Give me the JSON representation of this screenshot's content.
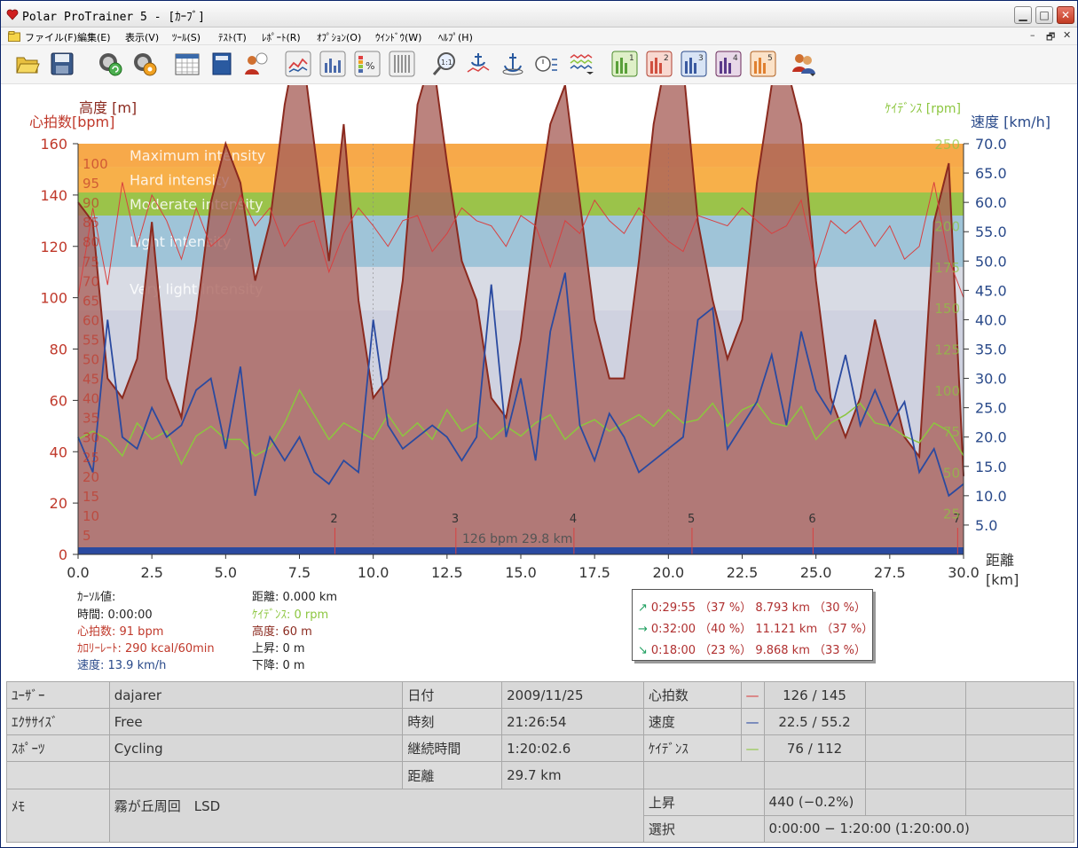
{
  "window": {
    "title": "Polar ProTrainer 5 - [ｶｰﾌﾞ]"
  },
  "menu": [
    "ファイル(F)",
    "編集(E)",
    "表示(V)",
    "ﾂｰﾙ(S)",
    "ﾃｽﾄ(T)",
    "ﾚﾎﾟｰﾄ(R)",
    "ｵﾌﾟｼｮﾝ(O)",
    "ｳｲﾝﾄﾞｳ(W)",
    "ﾍﾙﾌﾟ(H)"
  ],
  "toolbar": {
    "icons": [
      "open-folder-icon",
      "save-icon",
      "sync-icon",
      "settings-icon",
      "calendar-icon",
      "book-icon",
      "user-info-icon",
      "line-chart-icon",
      "bar-chart-icon",
      "percent-chart-icon",
      "table-icon",
      "zoom-1to1-icon",
      "anchor-chart-icon",
      "anchor-icon",
      "stopwatch-icon",
      "multi-line-icon",
      "view-1-icon",
      "view-2-icon",
      "view-3-icon",
      "view-4-icon",
      "view-5-icon",
      "users-icon"
    ],
    "view_numbers": [
      "1",
      "2",
      "3",
      "4",
      "5"
    ],
    "zoom_label": "1:1"
  },
  "chart_data": {
    "type": "line",
    "axes": {
      "left_hr": {
        "label": "心拍数[bpm]",
        "range": [
          0,
          160
        ],
        "ticks": [
          "0",
          "20",
          "40",
          "60",
          "80",
          "100",
          "120",
          "140",
          "160"
        ],
        "color": "#c0392b"
      },
      "left_alt": {
        "label": "高度 [m]",
        "ticks": [
          "5",
          "10",
          "15",
          "20",
          "25",
          "30",
          "35",
          "40",
          "45",
          "50",
          "55",
          "60",
          "65",
          "70",
          "75",
          "80",
          "85",
          "90",
          "95",
          "100"
        ],
        "color": "#c0392b"
      },
      "right_speed": {
        "label": "速度 [km/h]",
        "range": [
          0,
          70
        ],
        "ticks": [
          "5.0",
          "10.0",
          "15.0",
          "20.0",
          "25.0",
          "30.0",
          "35.0",
          "40.0",
          "45.0",
          "50.0",
          "55.0",
          "60.0",
          "65.0",
          "70.0"
        ],
        "color": "#2a4a8a"
      },
      "right_cadence": {
        "label": "ｹｲﾃﾞﾝｽ [rpm]",
        "ticks": [
          "25",
          "50",
          "75",
          "100",
          "125",
          "150",
          "175",
          "200",
          "250"
        ],
        "color": "#8cc63f"
      },
      "x": {
        "label": "距離",
        "unit": "[km]",
        "range": [
          0,
          30
        ],
        "ticks": [
          "0.0",
          "2.5",
          "5.0",
          "7.5",
          "10.0",
          "12.5",
          "15.0",
          "17.5",
          "20.0",
          "22.5",
          "25.0",
          "27.5",
          "30.0"
        ]
      }
    },
    "zones": [
      {
        "name": "Maximum intensity",
        "from": 151,
        "to": 160,
        "color": "#f7a94a"
      },
      {
        "name": "Hard intensity",
        "from": 141,
        "to": 151,
        "color": "#f7b04a"
      },
      {
        "name": "Moderate intensity",
        "from": 132,
        "to": 141,
        "color": "#9bc34a"
      },
      {
        "name": "Light intensity",
        "from": 112,
        "to": 132,
        "color": "#9fc4d8"
      },
      {
        "name": "Very light intensity",
        "from": 95,
        "to": 112,
        "color": "#d8dbe4"
      }
    ],
    "laps": [
      "2",
      "3",
      "4",
      "5",
      "6",
      "7"
    ],
    "lap_x": [
      8.7,
      12.8,
      16.8,
      20.8,
      24.9,
      29.8
    ],
    "cursor_label": "126 bpm 29.8 km",
    "series": [
      {
        "name": "高度",
        "color": "#8b2a1f",
        "x": [
          0,
          0.5,
          1,
          1.5,
          2,
          2.5,
          3,
          3.5,
          4,
          4.5,
          5,
          5.5,
          6,
          6.5,
          7,
          7.5,
          8,
          8.5,
          9,
          9.5,
          10,
          10.5,
          11,
          11.5,
          12,
          12.5,
          13,
          13.5,
          14,
          14.5,
          15,
          15.5,
          16,
          16.5,
          17,
          17.5,
          18,
          18.5,
          19,
          19.5,
          20,
          20.5,
          21,
          21.5,
          22,
          22.5,
          23,
          23.5,
          24,
          24.5,
          25,
          25.5,
          26,
          26.5,
          27,
          27.5,
          28,
          28.5,
          29,
          29.5,
          30
        ],
        "y": [
          90,
          85,
          45,
          40,
          50,
          85,
          45,
          35,
          60,
          90,
          105,
          95,
          70,
          85,
          115,
          135,
          105,
          75,
          110,
          65,
          40,
          45,
          70,
          115,
          128,
          100,
          75,
          65,
          40,
          35,
          55,
          85,
          110,
          120,
          90,
          60,
          45,
          45,
          75,
          110,
          130,
          125,
          85,
          65,
          50,
          60,
          95,
          120,
          125,
          110,
          70,
          40,
          30,
          40,
          60,
          45,
          30,
          25,
          85,
          100,
          20
        ]
      },
      {
        "name": "心拍数",
        "color": "#d84040",
        "x": [
          0,
          0.5,
          1,
          1.5,
          2,
          2.5,
          3,
          3.5,
          4,
          4.5,
          5,
          5.5,
          6,
          6.5,
          7,
          7.5,
          8,
          8.5,
          9,
          9.5,
          10,
          10.5,
          11,
          11.5,
          12,
          12.5,
          13,
          13.5,
          14,
          14.5,
          15,
          15.5,
          16,
          16.5,
          17,
          17.5,
          18,
          18.5,
          19,
          19.5,
          20,
          20.5,
          21,
          21.5,
          22,
          22.5,
          23,
          23.5,
          24,
          24.5,
          25,
          25.5,
          26,
          26.5,
          27,
          27.5,
          28,
          28.5,
          29,
          29.5,
          30
        ],
        "y": [
          100,
          135,
          105,
          145,
          120,
          140,
          130,
          115,
          135,
          120,
          125,
          140,
          128,
          135,
          120,
          128,
          130,
          110,
          125,
          135,
          128,
          120,
          130,
          132,
          118,
          125,
          135,
          130,
          128,
          120,
          132,
          128,
          112,
          130,
          125,
          138,
          130,
          125,
          135,
          128,
          122,
          118,
          132,
          130,
          128,
          135,
          130,
          125,
          128,
          138,
          112,
          130,
          125,
          130,
          120,
          128,
          115,
          120,
          145,
          115,
          100
        ]
      },
      {
        "name": "速度",
        "color": "#2a4aa0",
        "x": [
          0,
          0.5,
          1,
          1.5,
          2,
          2.5,
          3,
          3.5,
          4,
          4.5,
          5,
          5.5,
          6,
          6.5,
          7,
          7.5,
          8,
          8.5,
          9,
          9.5,
          10,
          10.5,
          11,
          11.5,
          12,
          12.5,
          13,
          13.5,
          14,
          14.5,
          15,
          15.5,
          16,
          16.5,
          17,
          17.5,
          18,
          18.5,
          19,
          19.5,
          20,
          20.5,
          21,
          21.5,
          22,
          22.5,
          23,
          23.5,
          24,
          24.5,
          25,
          25.5,
          26,
          26.5,
          27,
          27.5,
          28,
          28.5,
          29,
          29.5,
          30
        ],
        "y": [
          20,
          14,
          40,
          20,
          18,
          25,
          20,
          22,
          28,
          30,
          18,
          32,
          10,
          20,
          16,
          20,
          14,
          12,
          16,
          14,
          40,
          22,
          18,
          20,
          22,
          20,
          16,
          20,
          46,
          20,
          30,
          16,
          38,
          48,
          22,
          16,
          24,
          20,
          14,
          16,
          18,
          20,
          40,
          42,
          18,
          22,
          26,
          34,
          22,
          38,
          28,
          24,
          34,
          22,
          28,
          22,
          26,
          14,
          18,
          10,
          12
        ]
      },
      {
        "name": "ｹｲﾃﾞﾝｽ",
        "color": "#8cc63f",
        "x": [
          0,
          0.5,
          1,
          1.5,
          2,
          2.5,
          3,
          3.5,
          4,
          4.5,
          5,
          5.5,
          6,
          6.5,
          7,
          7.5,
          8,
          8.5,
          9,
          9.5,
          10,
          10.5,
          11,
          11.5,
          12,
          12.5,
          13,
          13.5,
          14,
          14.5,
          15,
          15.5,
          16,
          16.5,
          17,
          17.5,
          18,
          18.5,
          19,
          19.5,
          20,
          20.5,
          21,
          21.5,
          22,
          22.5,
          23,
          23.5,
          24,
          24.5,
          25,
          25.5,
          26,
          26.5,
          27,
          27.5,
          28,
          28.5,
          29,
          29.5,
          30
        ],
        "y": [
          70,
          75,
          70,
          60,
          80,
          70,
          75,
          55,
          72,
          78,
          70,
          70,
          60,
          65,
          80,
          100,
          85,
          70,
          80,
          75,
          70,
          85,
          72,
          80,
          70,
          88,
          75,
          80,
          70,
          78,
          72,
          80,
          85,
          70,
          78,
          82,
          75,
          80,
          85,
          78,
          88,
          80,
          82,
          92,
          78,
          88,
          92,
          80,
          78,
          90,
          70,
          80,
          85,
          92,
          80,
          78,
          72,
          68,
          80,
          75,
          60
        ]
      }
    ]
  },
  "cursor": {
    "title": "ｶｰｿﾙ値:",
    "time": "時間: 0:00:00",
    "hr": "心拍数: 91 bpm",
    "calorie": "ｶﾛﾘｰﾚｰﾄ: 290 kcal/60min",
    "speed": "速度: 13.9 km/h",
    "distance": "距離: 0.000 km",
    "cadence": "ｹｲﾃﾞﾝｽ: 0 rpm",
    "altitude": "高度: 60 m",
    "ascent": "上昇: 0 m",
    "descent": "下降: 0 m"
  },
  "zones_box": {
    "up": "0:29:55 （37 %） 8.793 km （30 %）",
    "flat": "0:32:00 （40 %） 11.121 km （37 %）",
    "down": "0:18:00 （23 %） 9.868 km （33 %）"
  },
  "summary": {
    "user_label": "ﾕｰｻﾞｰ",
    "user": "dajarer",
    "exercise_label": "ｴｸｻｻｲｽﾞ",
    "exercise": "Free",
    "sport_label": "ｽﾎﾟｰﾂ",
    "sport": "Cycling",
    "memo_label": "ﾒﾓ",
    "memo": "霧が丘周回　LSD",
    "date_label": "日付",
    "date": "2009/11/25",
    "time_label": "時刻",
    "time": "21:26:54",
    "duration_label": "継続時間",
    "duration": "1:20:02.6",
    "distance_label": "距離",
    "distance": "29.7 km",
    "hr_label": "心拍数",
    "hr": "126 / 145",
    "speed_label": "速度",
    "speed": "22.5 / 55.2",
    "cadence_label": "ｹｲﾃﾞﾝｽ",
    "cadence": "76 / 112",
    "ascent_label": "上昇",
    "ascent": "440 (−0.2%)",
    "select_label": "選択",
    "select": "0:00:00 − 1:20:00 (1:20:00.0)"
  }
}
